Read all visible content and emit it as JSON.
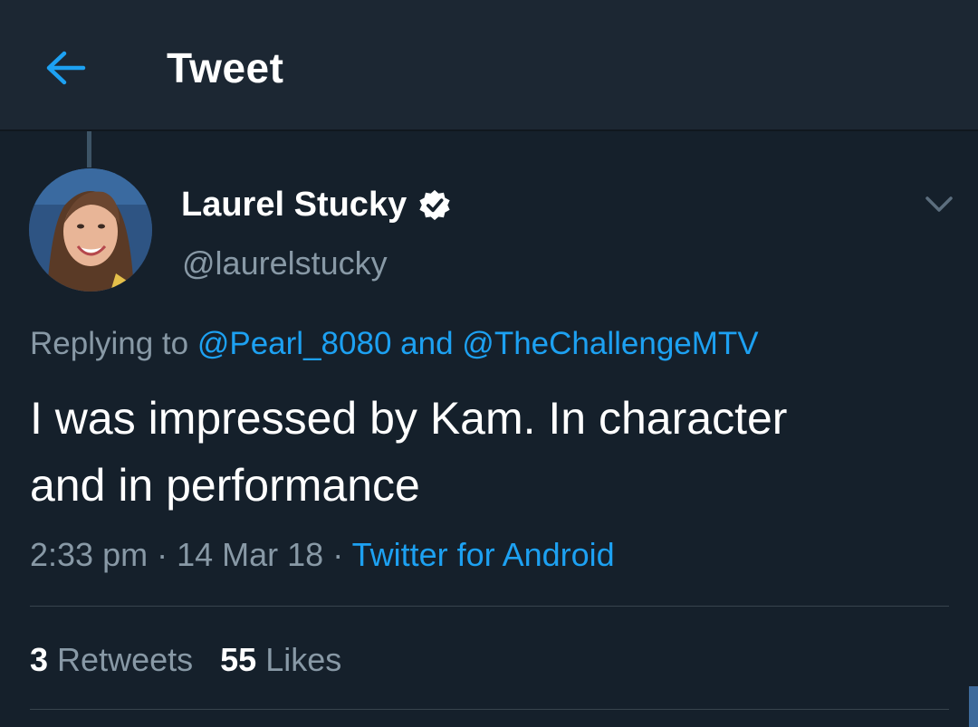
{
  "app_bar": {
    "title": "Tweet",
    "back_icon": "arrow-left-icon",
    "accent": "#1da1f2"
  },
  "tweet": {
    "author": {
      "display_name": "Laurel Stucky",
      "handle": "@laurelstucky",
      "verified": true,
      "verified_icon": "verified-badge-icon"
    },
    "menu_icon": "chevron-down-icon",
    "reply_context": {
      "prefix": "Replying to",
      "mention_1": "@Pearl_8080",
      "joiner": "and",
      "mention_2": "@TheChallengeMTV"
    },
    "text_line_1": "I was impressed by Kam. In character",
    "text_line_2": "and in performance",
    "time": "2:33 pm",
    "date": "14 Mar 18",
    "separator": "·",
    "source": "Twitter for Android",
    "retweets_count": "3",
    "retweets_label": "Retweets",
    "likes_count": "55",
    "likes_label": "Likes"
  },
  "colors": {
    "background": "#15202b",
    "header": "#1c2733",
    "secondary_text": "#8899a6",
    "link": "#1da1f2"
  }
}
